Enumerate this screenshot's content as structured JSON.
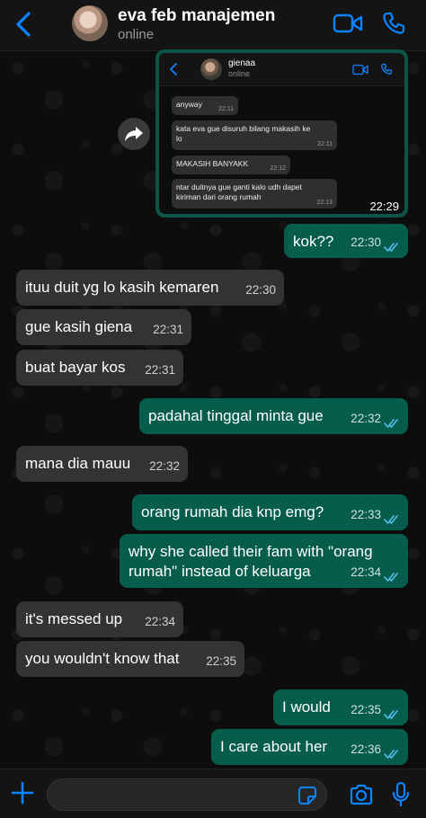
{
  "header": {
    "title": "eva feb manajemen",
    "status": "online"
  },
  "screenshot": {
    "contact_name": "gienaa",
    "contact_status": "online",
    "time": "22:29",
    "messages": [
      {
        "text": "anyway",
        "time": "22:11"
      },
      {
        "text": "kata eva gue disuruh bilang makasih ke lo",
        "time": "22:11"
      },
      {
        "text": "MAKASIH BANYAKK",
        "time": "22:12"
      },
      {
        "text": "ntar duitnya gue ganti kalo udh dapet kiriman dari orang rumah",
        "time": "22:13"
      }
    ]
  },
  "messages": [
    {
      "dir": "out",
      "text": "kok??",
      "time": "22:30"
    },
    {
      "dir": "in",
      "text": "ituu duit yg lo kasih kemaren",
      "time": "22:30"
    },
    {
      "dir": "in",
      "text": "gue kasih giena",
      "time": "22:31"
    },
    {
      "dir": "in",
      "text": "buat bayar kos",
      "time": "22:31"
    },
    {
      "dir": "out",
      "text": "padahal tinggal minta gue",
      "time": "22:32"
    },
    {
      "dir": "in",
      "text": "mana dia mauu",
      "time": "22:32"
    },
    {
      "dir": "out",
      "text": "orang rumah dia knp emg?",
      "time": "22:33"
    },
    {
      "dir": "out",
      "text": "why she called their fam with \"orang rumah\" instead of keluarga",
      "time": "22:34"
    },
    {
      "dir": "in",
      "text": "it's messed up",
      "time": "22:34"
    },
    {
      "dir": "in",
      "text": "you wouldn't know that",
      "time": "22:35"
    },
    {
      "dir": "out",
      "text": "I would",
      "time": "22:35"
    },
    {
      "dir": "out",
      "text": "I care about her",
      "time": "22:36"
    }
  ],
  "colors": {
    "accent": "#0a84ff",
    "outgoing_bubble": "#075d4c",
    "incoming_bubble": "#333333",
    "read_ticks": "#53bdeb"
  },
  "icons": [
    "back-chevron-icon",
    "video-call-icon",
    "phone-icon",
    "forward-icon",
    "plus-icon",
    "sticker-icon",
    "camera-icon",
    "microphone-icon"
  ]
}
